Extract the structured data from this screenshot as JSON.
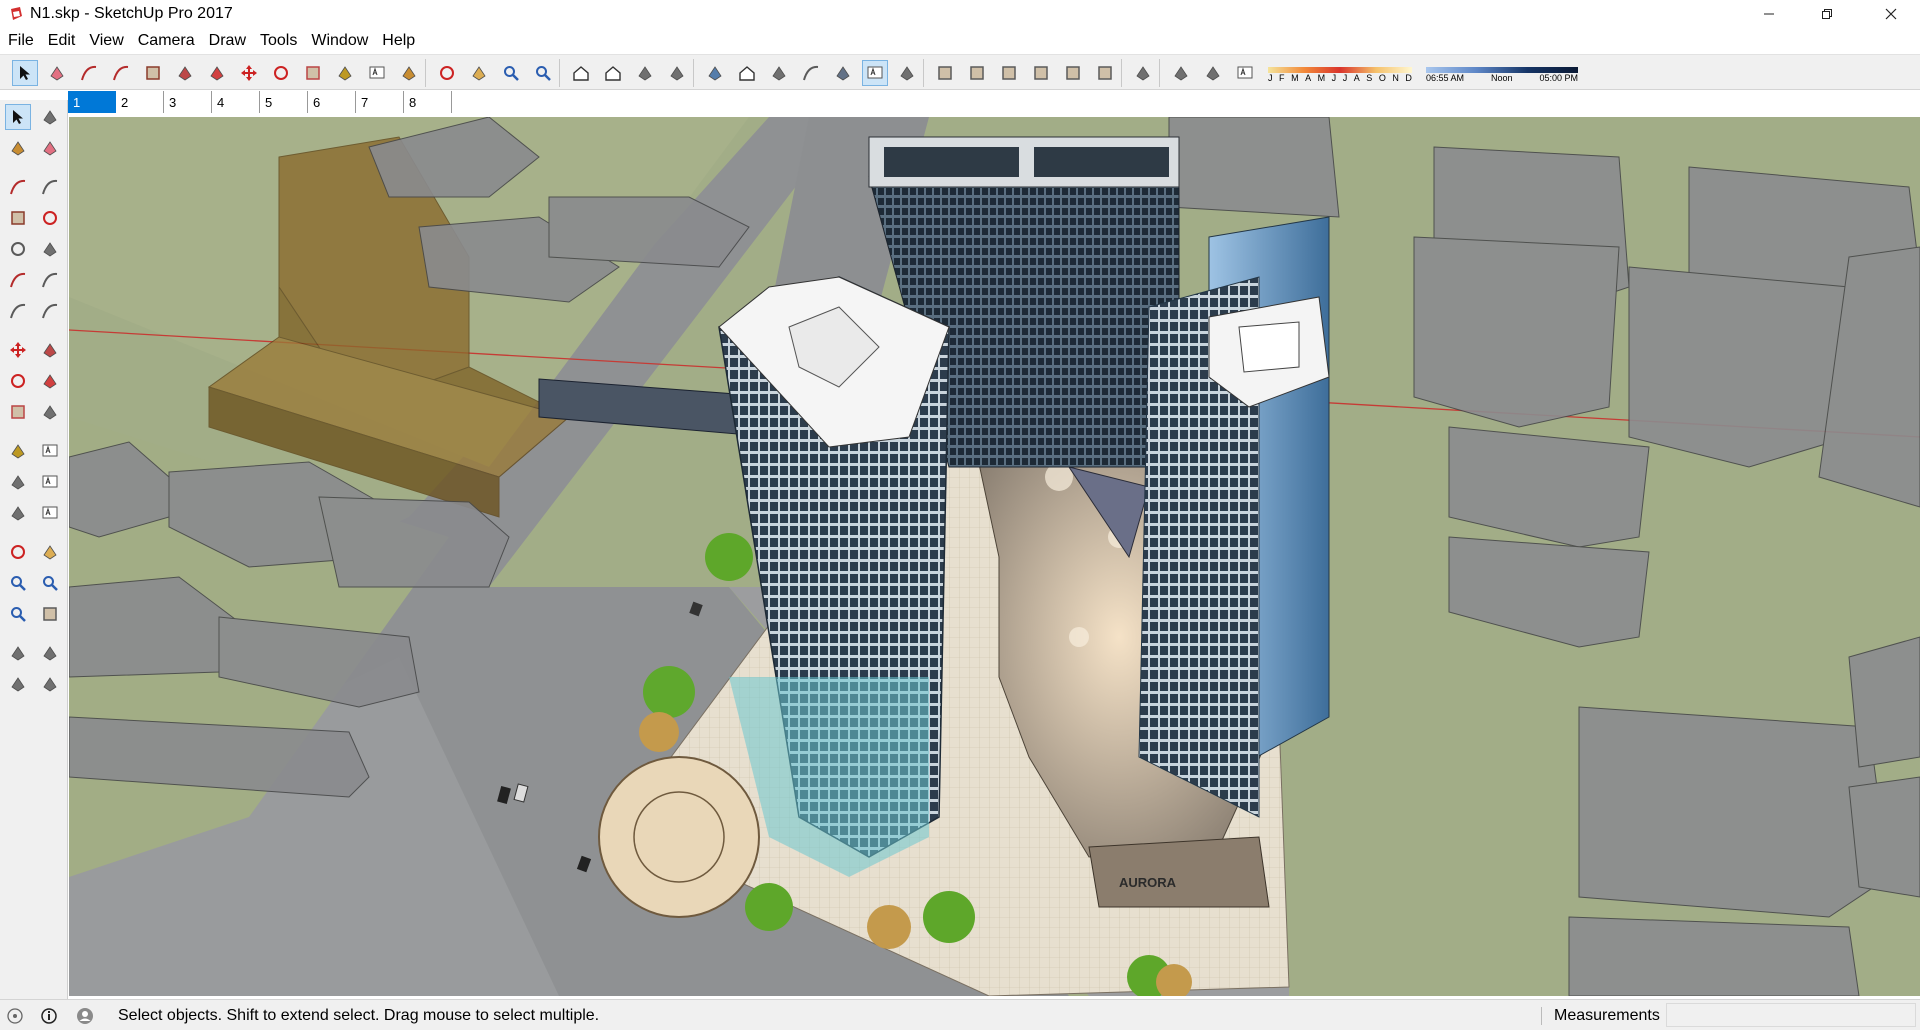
{
  "window": {
    "title": "N1.skp - SketchUp Pro 2017",
    "app_icon": "sketchup-logo-icon",
    "controls": [
      "minimize-icon",
      "maximize-icon",
      "close-icon"
    ]
  },
  "menu": [
    "File",
    "Edit",
    "View",
    "Camera",
    "Draw",
    "Tools",
    "Window",
    "Help"
  ],
  "toolbar": {
    "tools": [
      "select-icon",
      "eraser-icon",
      "line-icon",
      "arc-icon",
      "rectangle-icon",
      "push-pull-icon",
      "follow-me-icon",
      "move-icon",
      "rotate-icon",
      "scale-icon",
      "tape-measure-icon",
      "text-icon",
      "paint-bucket-icon",
      "orbit-icon",
      "pan-icon",
      "zoom-icon",
      "zoom-extents-icon",
      "warehouse-icon",
      "extension-warehouse-icon",
      "send-to-layout-icon",
      "extension-manager-icon",
      "xray-icon",
      "back-edges-icon",
      "wireframe-icon",
      "hidden-line-icon",
      "shaded-icon",
      "shaded-textures-icon",
      "monochrome-icon",
      "iso-view-icon",
      "top-view-icon",
      "front-view-icon",
      "right-view-icon",
      "back-view-icon",
      "left-view-icon",
      "shadows-toggle-icon",
      "add-location-icon",
      "toggle-terrain-icon",
      "photo-textures-icon"
    ],
    "active_tool": "select-icon",
    "active_style": "shaded-textures-icon",
    "months": [
      "J",
      "F",
      "M",
      "A",
      "M",
      "J",
      "J",
      "A",
      "S",
      "O",
      "N",
      "D"
    ],
    "time_labels": [
      "06:55 AM",
      "Noon",
      "05:00 PM"
    ]
  },
  "scene_tabs": [
    "1",
    "2",
    "3",
    "4",
    "5",
    "6",
    "7",
    "8"
  ],
  "active_scene": "1",
  "left_tools": [
    [
      "select-icon",
      "component-icon"
    ],
    [
      "paint-bucket-icon",
      "eraser-icon"
    ],
    [
      "line-icon",
      "freehand-icon"
    ],
    [
      "rectangle-icon",
      "rotated-rectangle-icon"
    ],
    [
      "circle-icon",
      "polygon-icon"
    ],
    [
      "arc-icon",
      "two-point-arc-icon"
    ],
    [
      "three-point-arc-icon",
      "pie-icon"
    ],
    [
      "move-icon",
      "push-pull-icon"
    ],
    [
      "rotate-icon",
      "follow-me-icon"
    ],
    [
      "scale-icon",
      "offset-icon"
    ],
    [
      "tape-measure-icon",
      "dimension-icon"
    ],
    [
      "protractor-icon",
      "text-icon"
    ],
    [
      "axes-icon",
      "3d-text-icon"
    ],
    [
      "orbit-icon",
      "pan-icon"
    ],
    [
      "zoom-icon",
      "zoom-window-icon"
    ],
    [
      "zoom-extents-icon",
      "previous-view-icon"
    ],
    [
      "position-camera-icon",
      "look-around-icon"
    ],
    [
      "walk-icon",
      "section-plane-icon"
    ]
  ],
  "model": {
    "signage": "AURORA"
  },
  "status": {
    "icons": [
      "geo-location-icon",
      "credits-icon",
      "user-account-icon"
    ],
    "message": "Select objects. Shift to extend select. Drag mouse to select multiple.",
    "measurements_label": "Measurements",
    "measurements_value": ""
  }
}
